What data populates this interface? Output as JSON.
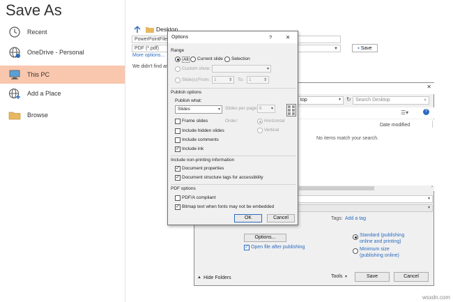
{
  "backstage": {
    "title": "Save As",
    "places": [
      {
        "label": "Recent",
        "icon": "clock-icon"
      },
      {
        "label": "OneDrive - Personal",
        "icon": "globe-icon"
      },
      {
        "label": "This PC",
        "icon": "computer-icon",
        "selected": true
      },
      {
        "label": "Add a Place",
        "icon": "globe-plus-icon"
      },
      {
        "label": "Browse",
        "icon": "folder-icon"
      }
    ]
  },
  "location": {
    "current_folder": "Desktop",
    "filename_value": "PowerPointFileN",
    "filetype_value": "PDF (*.pdf)",
    "more_options": "More options...",
    "save_label": "Save",
    "message": "We didn't find an"
  },
  "publish": {
    "crumb": "top",
    "search_placeholder": "Search Desktop",
    "col_date_modified": "Date modified",
    "empty_message": "No items match your search.",
    "tags_label": "Tags:",
    "tags_link": "Add a tag",
    "options_button": "Options...",
    "open_after": "Open file after publishing",
    "standard_line1": "Standard (publishing",
    "standard_line2": "online and printing)",
    "minimum_line1": "Minimum size",
    "minimum_line2": "(publishing online)",
    "hide_folders": "Hide Folders",
    "tools": "Tools",
    "save": "Save",
    "cancel": "Cancel"
  },
  "options": {
    "title": "Options",
    "help": "?",
    "close": "✕",
    "range": {
      "heading": "Range",
      "all": "All",
      "current_slide": "Current slide",
      "selection": "Selection",
      "custom_show": "Custom show:",
      "slides": "Slide(s)",
      "from": "From:",
      "from_value": "1",
      "to": "To:",
      "to_value": "1"
    },
    "publish_options": {
      "heading": "Publish options",
      "publish_what": "Publish what:",
      "publish_value": "Slides",
      "slides_per_page": "Slides per page:",
      "slides_per_page_value": "6",
      "order": "Order:",
      "horizontal": "Horizontal",
      "vertical": "Vertical",
      "frame_slides": "Frame slides",
      "include_hidden": "Include hidden slides",
      "include_comments": "Include comments",
      "include_ink": "Include ink"
    },
    "non_printing": {
      "heading": "Include non-printing information",
      "doc_properties": "Document properties",
      "structure_tags": "Document structure tags for accessibility"
    },
    "pdf_options": {
      "heading": "PDF options",
      "pdfa": "PDF/A compliant",
      "bitmap_text": "Bitmap text when fonts may not be embedded"
    },
    "ok": "OK",
    "cancel": "Cancel"
  },
  "colors": {
    "selected_place": "#f9c7ad",
    "link": "#2b6bbf",
    "dialog_bg": "#f0f0f0"
  }
}
